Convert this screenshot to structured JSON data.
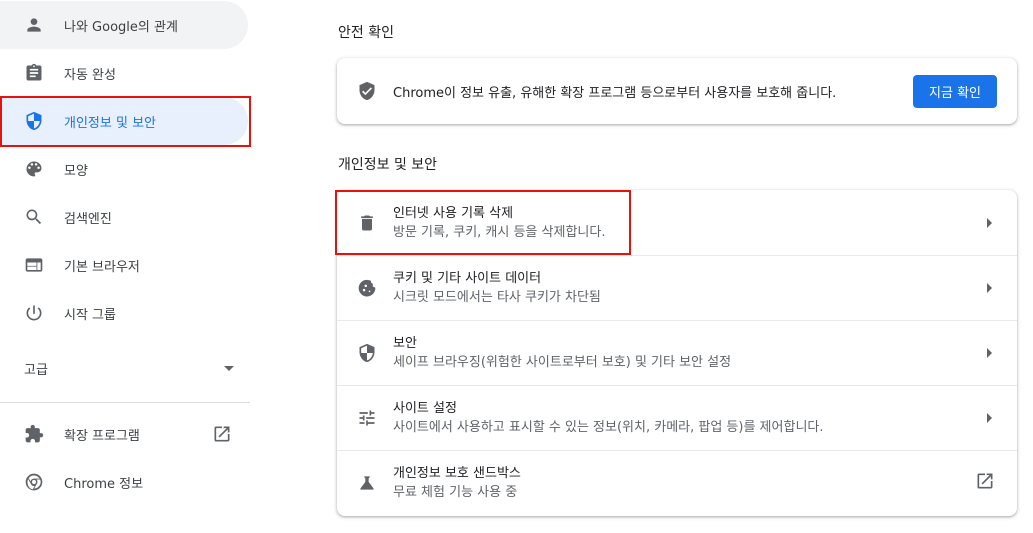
{
  "sidebar": {
    "items": [
      {
        "label": "나와 Google의 관계",
        "icon": "person-icon"
      },
      {
        "label": "자동 완성",
        "icon": "clipboard-icon"
      },
      {
        "label": "개인정보 및 보안",
        "icon": "shield-icon"
      },
      {
        "label": "모양",
        "icon": "palette-icon"
      },
      {
        "label": "검색엔진",
        "icon": "search-icon"
      },
      {
        "label": "기본 브라우저",
        "icon": "browser-icon"
      },
      {
        "label": "시작 그룹",
        "icon": "power-icon"
      }
    ],
    "advanced_label": "고급",
    "extensions_label": "확장 프로그램",
    "about_label": "Chrome 정보"
  },
  "safety_check": {
    "title": "안전 확인",
    "text": "Chrome이 정보 유출, 유해한 확장 프로그램 등으로부터 사용자를 보호해 줍니다.",
    "button_label": "지금 확인"
  },
  "privacy": {
    "title": "개인정보 및 보안",
    "rows": [
      {
        "title": "인터넷 사용 기록 삭제",
        "subtitle": "방문 기록, 쿠키, 캐시 등을 삭제합니다.",
        "icon": "trash-icon"
      },
      {
        "title": "쿠키 및 기타 사이트 데이터",
        "subtitle": "시크릿 모드에서는 타사 쿠키가 차단됨",
        "icon": "cookie-icon"
      },
      {
        "title": "보안",
        "subtitle": "세이프 브라우징(위험한 사이트로부터 보호) 및 기타 보안 설정",
        "icon": "shield-half-icon"
      },
      {
        "title": "사이트 설정",
        "subtitle": "사이트에서 사용하고 표시할 수 있는 정보(위치, 카메라, 팝업 등)를 제어합니다.",
        "icon": "tune-icon"
      },
      {
        "title": "개인정보 보호 샌드박스",
        "subtitle": "무료 체험 기능 사용 중",
        "icon": "flask-icon"
      }
    ]
  },
  "colors": {
    "accent": "#1a73e8",
    "active_bg": "#e8f0fe",
    "annotation_red": "#e8120c"
  }
}
